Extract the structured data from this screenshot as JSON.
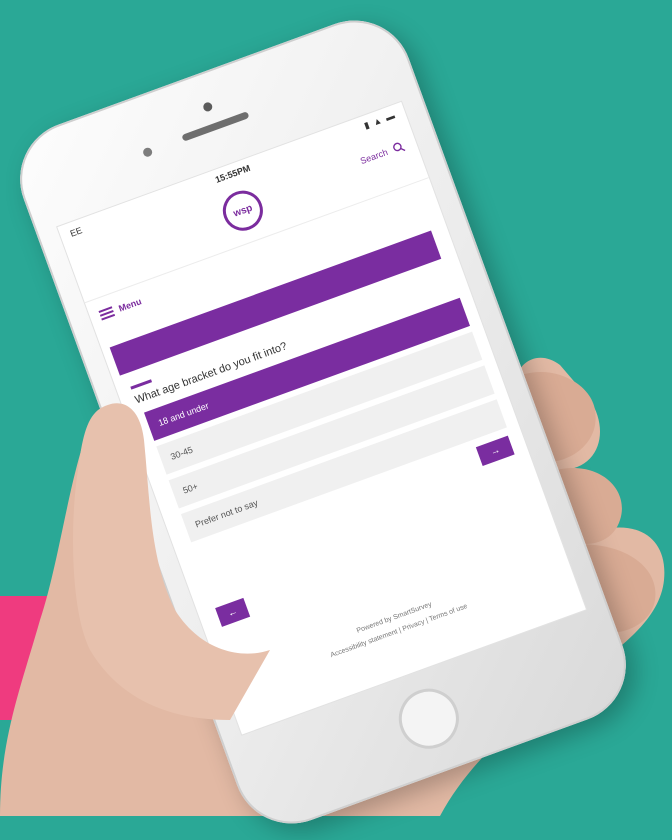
{
  "status": {
    "carrier": "EE",
    "time": "15:55PM",
    "icons": "▮ ▲ ▬"
  },
  "header": {
    "logo_text": "wsp",
    "search_label": "Search"
  },
  "nav": {
    "menu_label": "Menu"
  },
  "survey": {
    "question": "What age bracket do you fit into?",
    "options": [
      "18 and under",
      "30-45",
      "50+",
      "Prefer not to say"
    ],
    "selected_index": 0,
    "progress_fraction": 0.1,
    "next_label": "→",
    "back_label": "←"
  },
  "footer": {
    "powered_by": "Powered by SmartSurvey",
    "policy": "Accessibility statement | Privacy | Terms of use"
  },
  "colors": {
    "background": "#2aa896",
    "accent": "#7a2da0",
    "pink": "#ef3b7f"
  }
}
